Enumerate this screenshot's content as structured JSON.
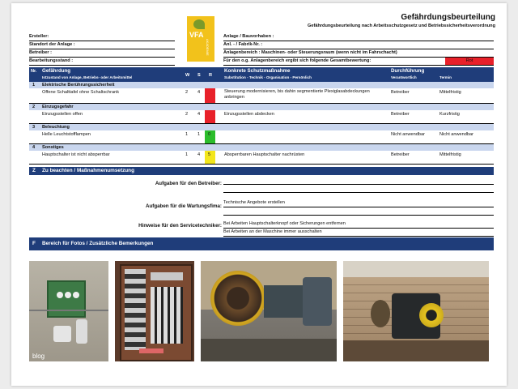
{
  "header": {
    "title": "Gefährdungsbeurteilung",
    "subtitle": "Gefährdungsbeurteilung nach Arbeitsschutzgesetz und Betriebssicherheitsverordnung",
    "logo_text": "VFA",
    "logo_sub": "AKADEMIE"
  },
  "left_fields": [
    "Ersteller:",
    "Standort der Anlage :",
    "Betreiber :",
    "Bearbeitungsstand :"
  ],
  "right_fields": [
    "Anlage / Bauvorhaben :",
    "Anl. - / Fabrik-Nr. :",
    "Anlagenbereich :  Maschinen- oder Steuerungsraum (wenn nicht im Fahrschacht)",
    "Für den o.g. Anlagenbereich ergibt sich folgende Gesamtbewertung:"
  ],
  "overall_rating": "Rot",
  "table_header": {
    "nr": "Nr.",
    "hazard": "Gefährdung",
    "hazard_sub": "Istzustand von Anlage, Betriebs- oder Arbeitsmittel",
    "w": "W",
    "s": "S",
    "r": "R",
    "measure": "Konkrete Schutzmaßnahme",
    "measure_sub": "Substitution - Technik - Organisation - Persönlich",
    "execution": "Durchführung",
    "responsible": "Verantwortlich",
    "deadline": "Termin"
  },
  "sections": [
    {
      "nr": "1",
      "title": "Elektrische Berührungssicherheit",
      "state": "Offene Schalttafel ohne Schaltschrank",
      "w": "2",
      "s": "4",
      "r": "",
      "risk_color": "#e8212a",
      "measure": "Steuerung modernisieren, bis dahin segmentierte Plexiglasabdeckungen anbringen",
      "responsible": "Betreiber",
      "deadline": "Mittelfristig"
    },
    {
      "nr": "2",
      "title": "Einzugsgefahr",
      "state": "Einzugsstellen offen",
      "w": "2",
      "s": "4",
      "r": "",
      "risk_color": "#e8212a",
      "measure": "Einzugsstellen abdecken",
      "responsible": "Betreiber",
      "deadline": "Kurzfristig"
    },
    {
      "nr": "3",
      "title": "Beleuchtung",
      "state": "Helle Leuchtstofflampen",
      "w": "1",
      "s": "1",
      "r": "0",
      "risk_color": "#2bbd2b",
      "measure": "",
      "responsible": "Nicht anwendbar",
      "deadline": "Nicht anwendbar"
    },
    {
      "nr": "4",
      "title": "Sonstiges",
      "state": "Hauptschalter ist nicht absperrbar",
      "w": "1",
      "s": "4",
      "r": "5",
      "risk_color": "#f3e61c",
      "measure": "Absperrbaren Hauptschalter nachrüsten",
      "responsible": "Betreiber",
      "deadline": "Mittelfristig"
    }
  ],
  "z_section": {
    "code": "Z",
    "title": "Zu beachten / Maßnahmenumsetzung",
    "rows": [
      {
        "label": "Aufgaben für den Betreiber:",
        "lines": [
          "",
          ""
        ]
      },
      {
        "label": "Aufgaben für die Wartungsfima:",
        "lines": [
          "Technische Angebote erstellen",
          ""
        ]
      },
      {
        "label": "Hinweise für den Servicetechniker:",
        "lines": [
          "Bei Arbeiten Hauptschalterknopf oder Sicherungen entfernen",
          "Bei Arbeiten an der Maschine immer ausschalten"
        ]
      }
    ]
  },
  "f_section": {
    "code": "F",
    "title": "Bereich für Fotos / Zusätzliche Bemerkungen"
  },
  "photos": [
    {
      "name": "photo-switch-box",
      "caption": "blog"
    },
    {
      "name": "photo-switch-panel"
    },
    {
      "name": "photo-machine"
    },
    {
      "name": "photo-machine-room"
    }
  ],
  "colors": {
    "header_blue": "#1f3d7a",
    "light_blue": "#c9d6ee",
    "red": "#e8212a",
    "green": "#2bbd2b",
    "yellow": "#f3e61c",
    "logo_yellow": "#f2c21b"
  }
}
